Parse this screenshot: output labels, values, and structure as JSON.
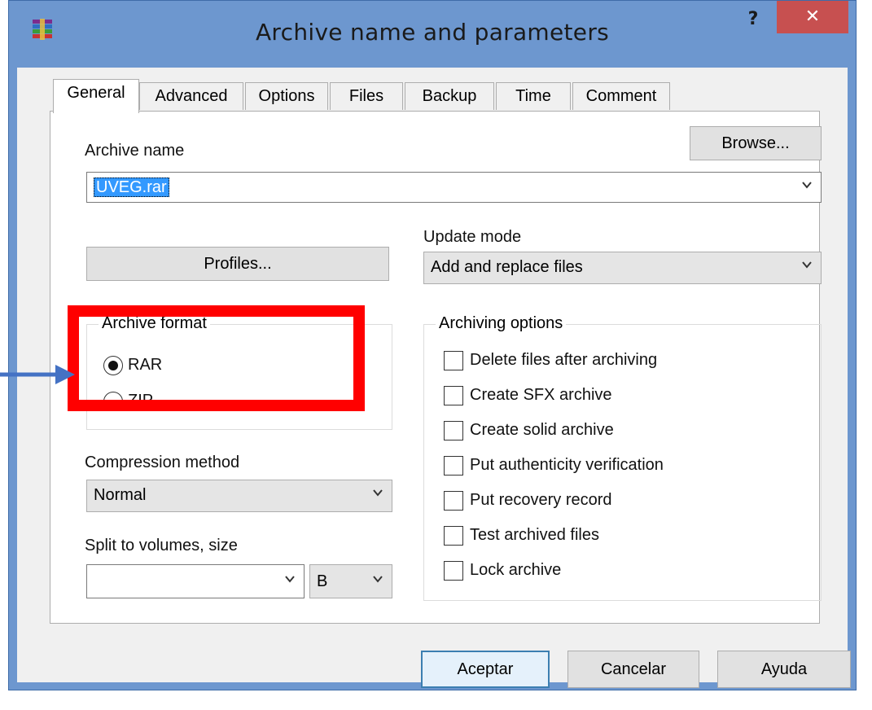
{
  "window": {
    "title": "Archive name and parameters",
    "help": "?",
    "close": "✕"
  },
  "tabs": [
    {
      "label": "General",
      "active": true
    },
    {
      "label": "Advanced"
    },
    {
      "label": "Options"
    },
    {
      "label": "Files"
    },
    {
      "label": "Backup"
    },
    {
      "label": "Time"
    },
    {
      "label": "Comment"
    }
  ],
  "general": {
    "archive_name_label": "Archive name",
    "archive_name_value": "UVEG.rar",
    "browse_button": "Browse...",
    "profiles_button": "Profiles...",
    "update_mode_label": "Update mode",
    "update_mode_value": "Add and replace files",
    "archive_format": {
      "title": "Archive format",
      "options": [
        {
          "label": "RAR",
          "selected": true
        },
        {
          "label": "ZIP",
          "selected": false
        }
      ]
    },
    "compression_label": "Compression method",
    "compression_value": "Normal",
    "split_label": "Split to volumes, size",
    "split_value": "",
    "split_unit": "B",
    "archiving_options": {
      "title": "Archiving options",
      "items": [
        {
          "label": "Delete files after archiving",
          "checked": false
        },
        {
          "label": "Create SFX archive",
          "checked": false
        },
        {
          "label": "Create solid archive",
          "checked": false
        },
        {
          "label": "Put authenticity verification",
          "checked": false
        },
        {
          "label": "Put recovery record",
          "checked": false
        },
        {
          "label": "Test archived files",
          "checked": false
        },
        {
          "label": "Lock archive",
          "checked": false
        }
      ]
    }
  },
  "footer": {
    "ok": "Aceptar",
    "cancel": "Cancelar",
    "help": "Ayuda"
  },
  "colors": {
    "title_bar": "#6d97cf",
    "close_button": "#c75050",
    "highlight_box": "#ff0000",
    "arrow": "#4472c4"
  }
}
